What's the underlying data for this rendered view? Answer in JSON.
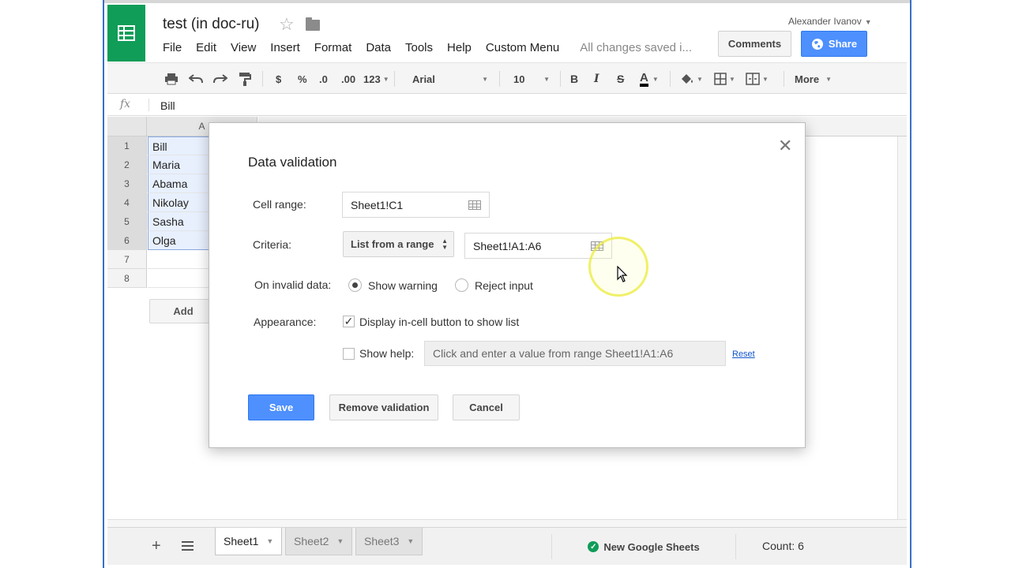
{
  "header": {
    "title": "test (in doc-ru)",
    "user": "Alexander Ivanov",
    "comments_label": "Comments",
    "share_label": "Share",
    "menu": [
      "File",
      "Edit",
      "View",
      "Insert",
      "Format",
      "Data",
      "Tools",
      "Help",
      "Custom Menu"
    ],
    "save_status": "All changes saved i..."
  },
  "toolbar": {
    "currency": "$",
    "percent": "%",
    "decrease_decimal": ".0",
    "increase_decimal": ".00",
    "number_format": "123",
    "font": "Arial",
    "font_size": "10",
    "bold": "B",
    "italic": "I",
    "strike": "S",
    "text_color": "A",
    "more": "More"
  },
  "formula_bar": {
    "fx": "fx",
    "value": "Bill"
  },
  "grid": {
    "column_a": "A",
    "rows": [
      {
        "num": "1",
        "value": "Bill"
      },
      {
        "num": "2",
        "value": "Maria"
      },
      {
        "num": "3",
        "value": "Abama"
      },
      {
        "num": "4",
        "value": "Nikolay"
      },
      {
        "num": "5",
        "value": "Sasha"
      },
      {
        "num": "6",
        "value": "Olga"
      },
      {
        "num": "7",
        "value": ""
      },
      {
        "num": "8",
        "value": ""
      }
    ],
    "add_label": "Add"
  },
  "dialog": {
    "title": "Data validation",
    "cell_range_label": "Cell range:",
    "cell_range_value": "Sheet1!C1",
    "criteria_label": "Criteria:",
    "criteria_select": "List from a range",
    "criteria_value": "Sheet1!A1:A6",
    "invalid_label": "On invalid data:",
    "show_warning": "Show warning",
    "reject_input": "Reject input",
    "appearance_label": "Appearance:",
    "display_button": "Display in-cell button to show list",
    "show_help": "Show help:",
    "help_text": "Click and enter a value from range Sheet1!A1:A6",
    "reset": "Reset",
    "save": "Save",
    "remove": "Remove validation",
    "cancel": "Cancel"
  },
  "bottom": {
    "sheets": [
      "Sheet1",
      "Sheet2",
      "Sheet3"
    ],
    "status": "New Google Sheets",
    "count": "Count: 6"
  },
  "colors": {
    "brand_green": "#0f9d58",
    "accent_blue": "#4d90fe",
    "window_border": "#3a6fc9"
  }
}
